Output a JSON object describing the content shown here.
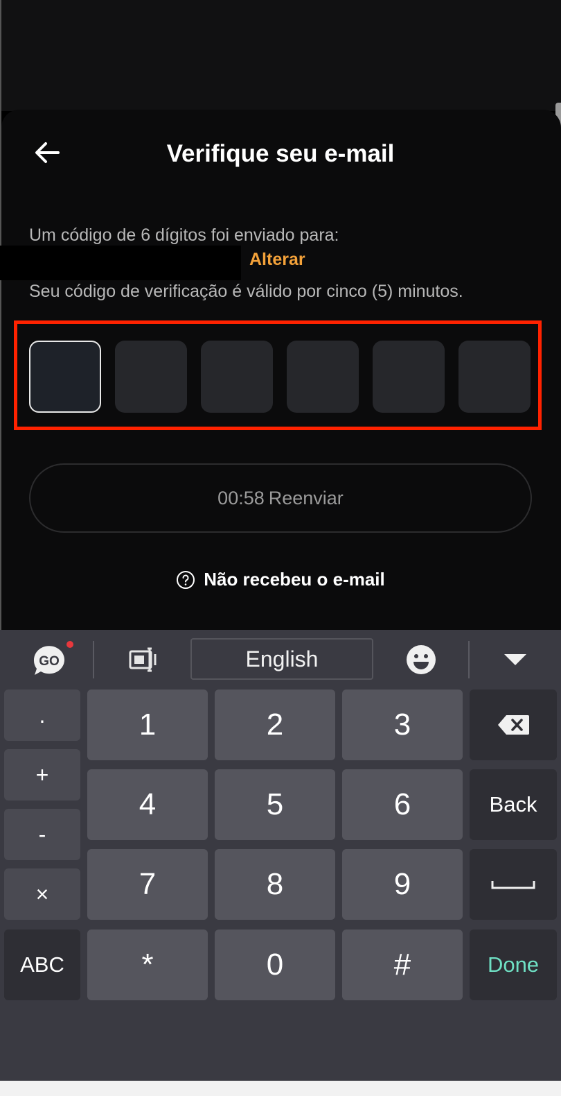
{
  "screen": {
    "title": "Verifique seu e-mail",
    "sent_text": "Um código de 6 dígitos foi enviado para:",
    "change_link": "Alterar",
    "validity_text": "Seu código de verificação é válido por cinco (5) minutos.",
    "code_length": 6,
    "resend": {
      "timer": "00:58",
      "label": "Reenviar"
    },
    "help_text": "Não recebeu o e-mail"
  },
  "colors": {
    "accent": "#f4a23a",
    "highlight_frame": "#ff2200",
    "done_key": "#6fe0c4",
    "notification_dot": "#e8383d"
  },
  "keyboard": {
    "language": "English",
    "toolbar_icons": [
      "go-keyboard-icon",
      "layout-icon",
      "emoji-icon",
      "collapse-icon"
    ],
    "side_keys": [
      ".",
      "+",
      "-",
      "×",
      "ABC"
    ],
    "rows": [
      [
        "1",
        "2",
        "3"
      ],
      [
        "4",
        "5",
        "6"
      ],
      [
        "7",
        "8",
        "9"
      ],
      [
        "*",
        "0",
        "#"
      ]
    ],
    "right_keys": {
      "back": "Back",
      "done": "Done"
    }
  }
}
